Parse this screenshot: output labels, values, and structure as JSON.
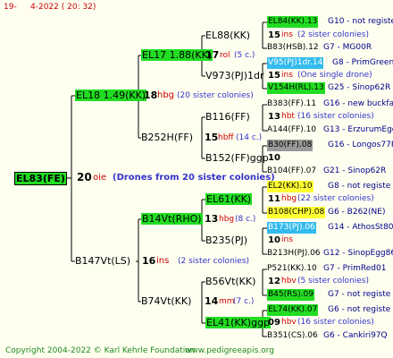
{
  "colors": {
    "green": "#22dd22",
    "yellow": "#ffff33",
    "grey": "#999999",
    "cyan": "#33bbee",
    "line": "#000000",
    "footer": "#1e8a1e",
    "header": "#cc0000"
  },
  "header": {
    "page": "19-",
    "date": "4-2022 ( 20: 32)"
  },
  "root": {
    "code": "EL83(FE)",
    "year": "20",
    "race": "oie",
    "note": "(Drones from 20 sister colonies)"
  },
  "g1": [
    {
      "code": "EL18 1.49(KK)",
      "year": "18",
      "race": "hbg",
      "note": "(20 sister colonies)"
    },
    {
      "code": "B147Vt(LS)",
      "year": "16",
      "race": "ins",
      "note": "(2 sister colonies)"
    }
  ],
  "g2": [
    {
      "code": "EL17 1.88(KK)",
      "year": "17",
      "race": "rol",
      "note": "(5 c.)"
    },
    {
      "code": "B252H(FF)",
      "year": "15",
      "race": "hbff",
      "note": "(14 c.)"
    },
    {
      "code": "B14Vt(RHO)",
      "year": "13",
      "race": "hbg",
      "note": "(8 c.)"
    },
    {
      "code": "B74Vt(KK)",
      "year": "14",
      "race": "mm",
      "note": "(7 c.)"
    }
  ],
  "g3": [
    {
      "code": "EL88(KK)"
    },
    {
      "code": "V973(PJ)1dr"
    },
    {
      "code": "B116(FF)"
    },
    {
      "code": "B152(FF)ggp"
    },
    {
      "code": "EL61(KK)"
    },
    {
      "code": "B235(PJ)"
    },
    {
      "code": "B56Vt(KK)"
    },
    {
      "code": "EL41(KK)ggp"
    }
  ],
  "g4": [
    {
      "code": "EL84(KK).13",
      "info": "G10 - not registe",
      "hl": "green"
    },
    {
      "year": "15",
      "race": "ins",
      "note": "(2 sister colonies)"
    },
    {
      "code": "B83(HSB).12",
      "info": "G7 - MG00R"
    },
    {
      "code": "V95(PJ)1dr.14",
      "info": "G8 - PrimGreen00",
      "hl": "cyan"
    },
    {
      "year": "15",
      "race": "ins",
      "note": "(One single drone)"
    },
    {
      "code": "V154H(RL).13",
      "info": "G25 - Sinop62R",
      "hl": "green"
    },
    {
      "code": "B383(FF).11",
      "info": "G16 - new buckfas"
    },
    {
      "year": "13",
      "race": "hbt",
      "note": "(16 sister colonies)"
    },
    {
      "code": "A144(FF).10",
      "info": "G13 - ErzurumEgg8"
    },
    {
      "code": "B30(FF).08",
      "info": "G16 - Longos77R",
      "hl": "grey"
    },
    {
      "year": "10",
      "race": "",
      "note": ""
    },
    {
      "code": "B104(FF).07",
      "info": "G21 - Sinop62R"
    },
    {
      "code": "EL2(KK).10",
      "info": "G8 - not registe",
      "hl": "yellow"
    },
    {
      "year": "11",
      "race": "hbg",
      "note": "(22 sister colonies)"
    },
    {
      "code": "B108(CHP).08",
      "info": "G6 - B262(NE)",
      "hl": "yellow"
    },
    {
      "code": "B173(PJ).06",
      "info": "G14 - AthosSt80R",
      "hl": "cyan"
    },
    {
      "year": "10",
      "race": "ins",
      "note": ""
    },
    {
      "code": "B213H(PJ).06",
      "info": "G12 - SinopEgg86R"
    },
    {
      "code": "P521(KK).10",
      "info": "G7 - PrimRed01"
    },
    {
      "year": "12",
      "race": "hbv",
      "note": "(5 sister colonies)"
    },
    {
      "code": "B45(RS).09",
      "info": "G7 - not registe",
      "hl": "green"
    },
    {
      "code": "EL74(KK).07",
      "info": "G6 - not registe",
      "hl": "green"
    },
    {
      "year": "09",
      "race": "hbv",
      "note": "(16 sister colonies)"
    },
    {
      "code": "B351(CS).06",
      "info": "G6 - Cankiri97Q"
    }
  ],
  "footer": {
    "copyright": "Copyright 2004-2022 © Karl Kehrle Foundation",
    "site": "www.pedigreeapis.org"
  }
}
